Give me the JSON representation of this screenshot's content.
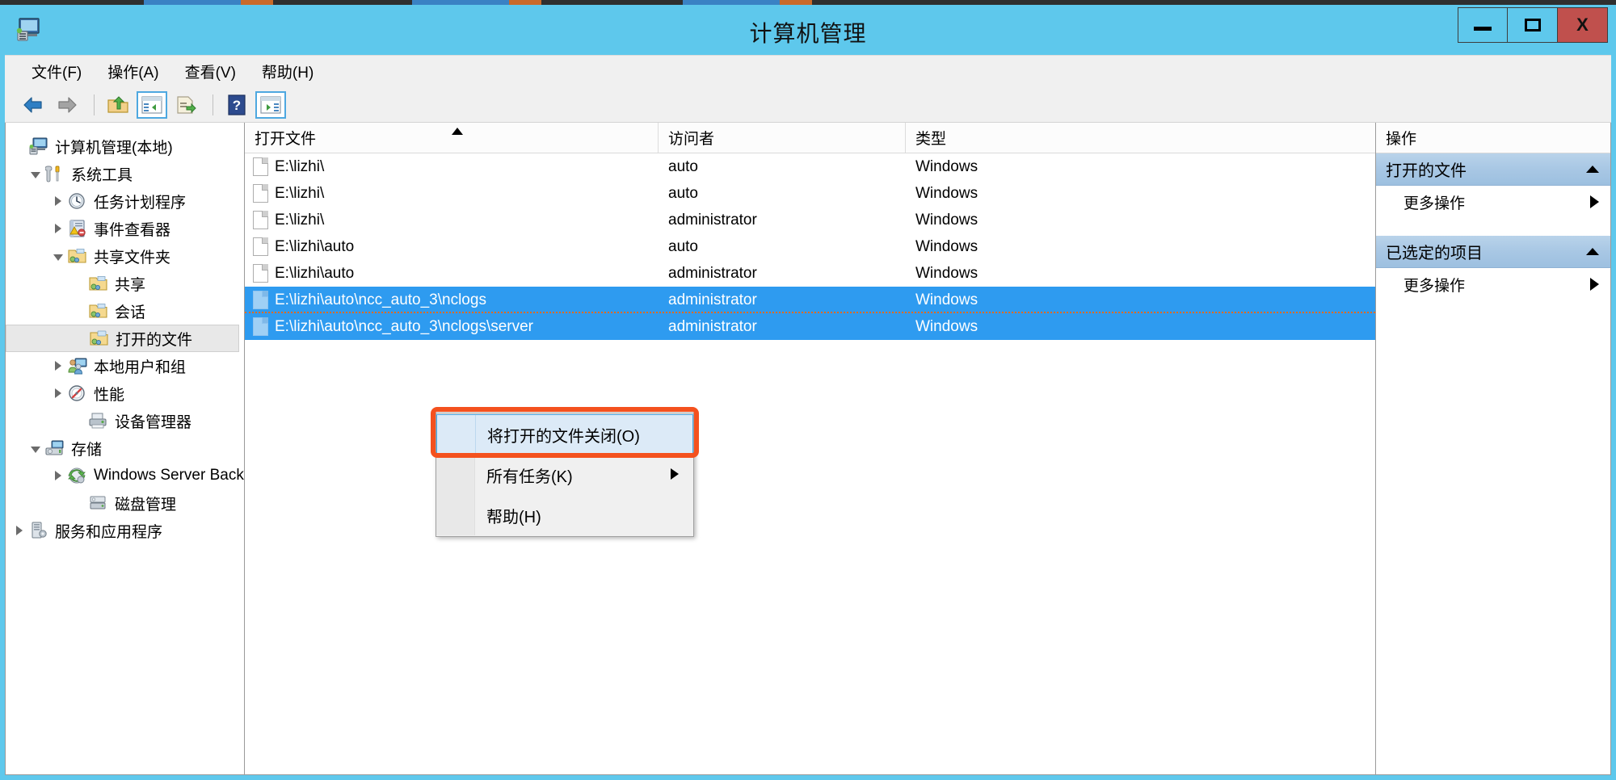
{
  "window": {
    "title": "计算机管理",
    "app_icon": "computer-management-icon",
    "minimize_label": "最小化",
    "maximize_label": "最大化",
    "close_label": "X",
    "titlebar_color": "#5ec8ec",
    "close_color": "#c0504d"
  },
  "menubar": {
    "items": [
      {
        "label": "文件(F)"
      },
      {
        "label": "操作(A)"
      },
      {
        "label": "查看(V)"
      },
      {
        "label": "帮助(H)"
      }
    ]
  },
  "toolbar": {
    "buttons": [
      {
        "name": "back-icon"
      },
      {
        "name": "forward-icon"
      },
      {
        "name": "up-folder-icon"
      },
      {
        "name": "show-hide-tree-icon"
      },
      {
        "name": "export-list-icon"
      },
      {
        "name": "help-icon"
      },
      {
        "name": "show-hide-action-pane-icon"
      }
    ]
  },
  "tree": {
    "items": [
      {
        "label": "计算机管理(本地)",
        "indent": 0,
        "twisty": "none",
        "icon": "computer-icon",
        "selected": false
      },
      {
        "label": "系统工具",
        "indent": 1,
        "twisty": "open",
        "icon": "tools-icon",
        "selected": false
      },
      {
        "label": "任务计划程序",
        "indent": 2,
        "twisty": "closed",
        "icon": "clock-icon",
        "selected": false
      },
      {
        "label": "事件查看器",
        "indent": 2,
        "twisty": "closed",
        "icon": "event-viewer-icon",
        "selected": false
      },
      {
        "label": "共享文件夹",
        "indent": 2,
        "twisty": "open",
        "icon": "shared-folder-icon",
        "selected": false
      },
      {
        "label": "共享",
        "indent": 3,
        "twisty": "none",
        "icon": "shared-folder-icon",
        "selected": false
      },
      {
        "label": "会话",
        "indent": 3,
        "twisty": "none",
        "icon": "shared-folder-icon",
        "selected": false
      },
      {
        "label": "打开的文件",
        "indent": 3,
        "twisty": "none",
        "icon": "open-files-icon",
        "selected": true
      },
      {
        "label": "本地用户和组",
        "indent": 2,
        "twisty": "closed",
        "icon": "users-groups-icon",
        "selected": false
      },
      {
        "label": "性能",
        "indent": 2,
        "twisty": "closed",
        "icon": "performance-icon",
        "selected": false
      },
      {
        "label": "设备管理器",
        "indent": 2,
        "twisty": "none",
        "icon": "device-manager-icon",
        "selected": false
      },
      {
        "label": "存储",
        "indent": 1,
        "twisty": "open",
        "icon": "storage-icon",
        "selected": false
      },
      {
        "label": "Windows Server Back",
        "indent": 2,
        "twisty": "closed",
        "icon": "backup-icon",
        "selected": false
      },
      {
        "label": "磁盘管理",
        "indent": 2,
        "twisty": "none",
        "icon": "disk-management-icon",
        "selected": false
      },
      {
        "label": "服务和应用程序",
        "indent": 1,
        "twisty": "closed",
        "icon": "services-icon",
        "selected": false
      }
    ]
  },
  "list": {
    "columns": [
      {
        "label": "打开文件",
        "sorted": true,
        "sort_dir": "asc"
      },
      {
        "label": "访问者",
        "sorted": false,
        "sort_dir": ""
      },
      {
        "label": "类型",
        "sorted": false,
        "sort_dir": ""
      }
    ],
    "rows": [
      {
        "open_file": "E:\\lizhi\\",
        "accessed_by": "auto",
        "type": "Windows",
        "selected": false,
        "focused": false
      },
      {
        "open_file": "E:\\lizhi\\",
        "accessed_by": "auto",
        "type": "Windows",
        "selected": false,
        "focused": false
      },
      {
        "open_file": "E:\\lizhi\\",
        "accessed_by": "administrator",
        "type": "Windows",
        "selected": false,
        "focused": false
      },
      {
        "open_file": "E:\\lizhi\\auto",
        "accessed_by": "auto",
        "type": "Windows",
        "selected": false,
        "focused": false
      },
      {
        "open_file": "E:\\lizhi\\auto",
        "accessed_by": "administrator",
        "type": "Windows",
        "selected": false,
        "focused": false
      },
      {
        "open_file": "E:\\lizhi\\auto\\ncc_auto_3\\nclogs",
        "accessed_by": "administrator",
        "type": "Windows",
        "selected": true,
        "focused": true
      },
      {
        "open_file": "E:\\lizhi\\auto\\ncc_auto_3\\nclogs\\server",
        "accessed_by": "administrator",
        "type": "Windows",
        "selected": true,
        "focused": false
      }
    ]
  },
  "actions": {
    "title": "操作",
    "groups": [
      {
        "header": "打开的文件",
        "items": [
          {
            "label": "更多操作",
            "submenu": true
          }
        ]
      },
      {
        "header": "已选定的项目",
        "items": [
          {
            "label": "更多操作",
            "submenu": true
          }
        ]
      }
    ]
  },
  "context_menu": {
    "items": [
      {
        "label": "将打开的文件关闭(O)",
        "highlighted": true,
        "submenu": false
      },
      {
        "label": "所有任务(K)",
        "highlighted": false,
        "submenu": true
      },
      {
        "label": "帮助(H)",
        "highlighted": false,
        "submenu": false
      }
    ],
    "highlight_ring_color": "#f4511e"
  }
}
